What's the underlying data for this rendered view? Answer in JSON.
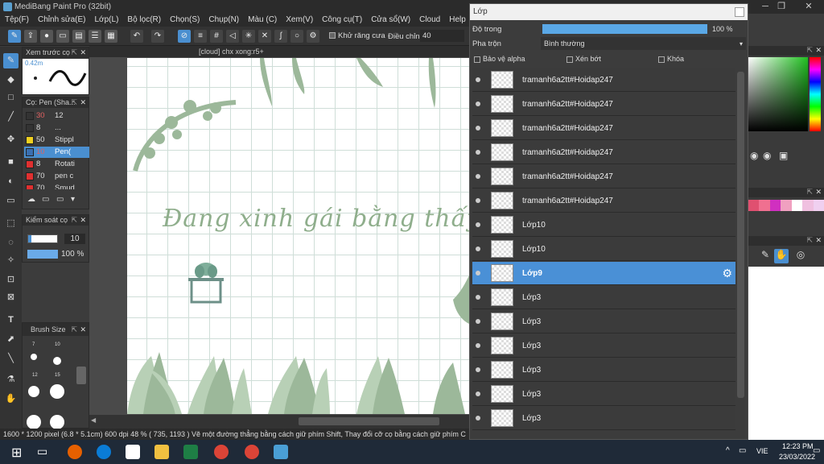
{
  "app": {
    "title": "MediBang Paint Pro (32bit)"
  },
  "menu": [
    "Tệp(F)",
    "Chỉnh sửa(E)",
    "Lớp(L)",
    "Bộ lọc(R)",
    "Chọn(S)",
    "Chụp(N)",
    "Màu (C)",
    "Xem(V)",
    "Công cụ(T)",
    "Cửa sổ(W)",
    "Cloud",
    "Help"
  ],
  "toolbar": {
    "antialias_label": "Khử răng cưa",
    "adjust_label": "Điều chỉnh",
    "adjust_value": "40"
  },
  "preview_panel": {
    "title": "Xem trước cọ",
    "size_text": "0.42m"
  },
  "brush_panel": {
    "title": "Cọ: Pen (Sha...",
    "items": [
      {
        "size": "30",
        "name": "12",
        "color": "#333333"
      },
      {
        "size": "8",
        "name": "...",
        "color": "#333333"
      },
      {
        "size": "50",
        "name": "Stippl",
        "color": "#f0d020"
      },
      {
        "size": "10",
        "name": "Pen(",
        "color": "#3a6fb0"
      },
      {
        "size": "8",
        "name": "Rotati",
        "color": "#e03030"
      },
      {
        "size": "70",
        "name": "pen c",
        "color": "#e03030"
      },
      {
        "size": "70",
        "name": "Smud",
        "color": "#e03030"
      }
    ]
  },
  "control_panel": {
    "title": "Kiểm soát cọ",
    "size_value": "10",
    "opacity_value": "100 %"
  },
  "brushsize_panel": {
    "title": "Brush Size",
    "labels": [
      "7",
      "10",
      "12",
      "15"
    ]
  },
  "canvas": {
    "tab": "[cloud] chx xong:r5+",
    "text": "Đang xinh gái bằng thấy đẹp"
  },
  "status": {
    "text": "1600 * 1200 pixel   (6.8 * 5.1cm)   600 dpi   48 %   ( 735, 1193 )   Vẽ một đường thẳng bằng cách giữ phím Shift, Thay đổi cỡ cọ bằng cách giữ phím C"
  },
  "layer_window": {
    "title": "Lớp",
    "opacity_label": "Độ trong",
    "opacity_value": "100 %",
    "blend_label": "Pha trộn",
    "blend_value": "Bình thường",
    "protect_alpha": "Bảo vệ alpha",
    "clipping": "Xén bớt",
    "lock": "Khóa",
    "layers": [
      "tramanh6a2tt#Hoidap247",
      "tramanh6a2tt#Hoidap247",
      "tramanh6a2tt#Hoidap247",
      "tramanh6a2tt#Hoidap247",
      "tramanh6a2tt#Hoidap247",
      "tramanh6a2tt#Hoidap247",
      "Lớp10",
      "Lớp10",
      "Lớp9",
      "Lớp3",
      "Lớp3",
      "Lớp3",
      "Lớp3",
      "Lớp3",
      "Lớp3"
    ],
    "selected_index": 8
  },
  "taskbar": {
    "time": "12:23 PM",
    "date": "23/03/2022",
    "lang": "VIE"
  },
  "colors": {
    "accent": "#4a90d6",
    "plant": "#9cb89a",
    "grid": "#cfded8"
  }
}
